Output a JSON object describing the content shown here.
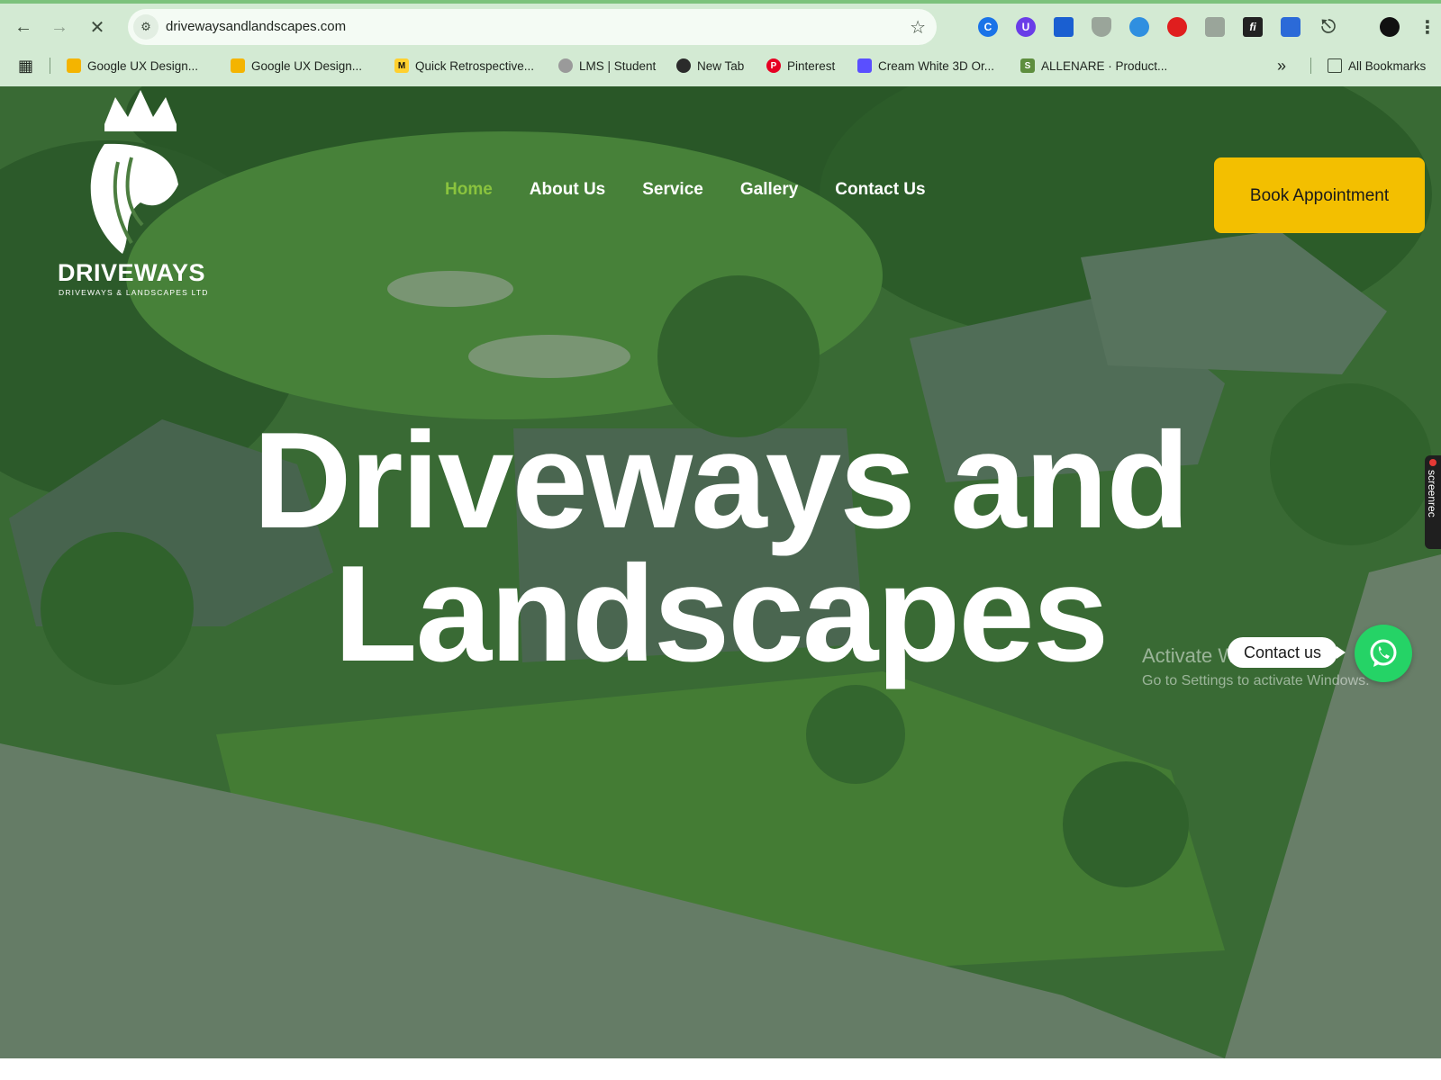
{
  "browser": {
    "url": "drivewaysandlandscapes.com",
    "extensions": [
      "C",
      "U",
      "",
      "",
      "",
      "",
      "",
      "fi",
      "",
      ""
    ],
    "bookmarks": [
      {
        "label": "Google UX Design...",
        "icon": "slides-icon",
        "color": "#f4b400"
      },
      {
        "label": "Google UX Design...",
        "icon": "slides-icon",
        "color": "#f4b400"
      },
      {
        "label": "Quick Retrospective...",
        "icon": "miro-icon",
        "color": "#ffd02f"
      },
      {
        "label": "LMS | Student",
        "icon": "lms-icon",
        "color": "#6b6b6b"
      },
      {
        "label": "New Tab",
        "icon": "globe-icon",
        "color": "#2b2b2b"
      },
      {
        "label": "Pinterest",
        "icon": "pinterest-icon",
        "color": "#e60023"
      },
      {
        "label": "Cream White 3D Or...",
        "icon": "canva-icon",
        "color": "#5a4fff"
      },
      {
        "label": "ALLENARE · Product...",
        "icon": "shopify-icon",
        "color": "#5e8e3e"
      }
    ],
    "all_bookmarks_label": "All Bookmarks"
  },
  "site": {
    "logo_wordmark": "DRIVEWAYS",
    "logo_tagline": "DRIVEWAYS & LANDSCAPES LTD",
    "nav": [
      "Home",
      "About Us",
      "Service",
      "Gallery",
      "Contact Us"
    ],
    "book_button": "Book Appointment",
    "headline": "Driveways and Landscapes",
    "contact_pill": "Contact us"
  },
  "overlay": {
    "activate_title": "Activate Windows",
    "activate_sub": "Go to Settings to activate Windows.",
    "recorder_label": "screenrec"
  },
  "colors": {
    "nav_active": "#8ac33e",
    "book_button": "#f3bf00",
    "whatsapp": "#25d366",
    "browser_chrome": "#d3ead3"
  }
}
